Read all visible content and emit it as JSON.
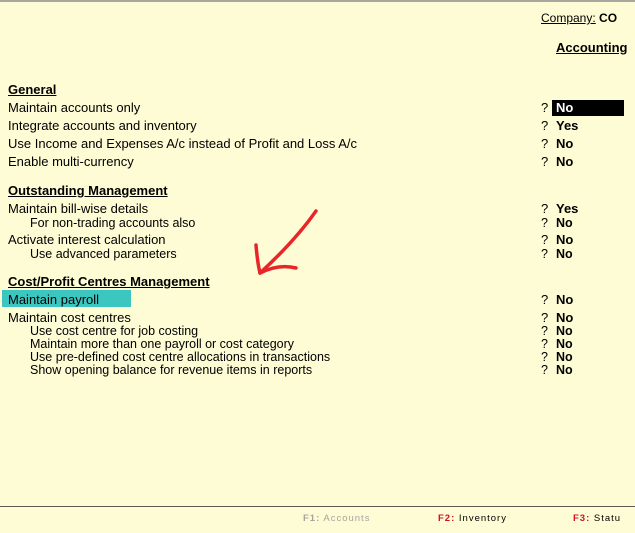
{
  "header": {
    "company_label": "Company:",
    "company_value": "CO",
    "screen_title": "Accounting"
  },
  "sections": {
    "general": {
      "heading": "General",
      "rows": [
        {
          "label": "Maintain accounts only",
          "q": "?",
          "value": "No"
        },
        {
          "label": "Integrate accounts and inventory",
          "q": "?",
          "value": "Yes"
        },
        {
          "label": "Use Income and Expenses A/c instead of Profit and Loss A/c",
          "q": "?",
          "value": "No"
        },
        {
          "label": "Enable multi-currency",
          "q": "?",
          "value": "No"
        }
      ]
    },
    "outstanding": {
      "heading": "Outstanding Management",
      "rows": [
        {
          "label": "Maintain bill-wise details",
          "q": "?",
          "value": "Yes"
        },
        {
          "label": "For non-trading accounts also",
          "q": "?",
          "value": "No"
        },
        {
          "label": "Activate interest calculation",
          "q": "?",
          "value": "No"
        },
        {
          "label": "Use advanced parameters",
          "q": "?",
          "value": "No"
        }
      ]
    },
    "cost": {
      "heading": "Cost/Profit Centres Management",
      "rows": [
        {
          "label": "Maintain payroll",
          "q": "?",
          "value": "No"
        },
        {
          "label": "Maintain cost centres",
          "q": "?",
          "value": "No"
        },
        {
          "label": "Use cost centre for job costing",
          "q": "?",
          "value": "No"
        },
        {
          "label": "Maintain more than one payroll or cost category",
          "q": "?",
          "value": "No"
        },
        {
          "label": "Use pre-defined cost centre allocations in transactions",
          "q": "?",
          "value": "No"
        },
        {
          "label": "Show opening balance for revenue items in reports",
          "q": "?",
          "value": "No"
        }
      ]
    }
  },
  "function_keys": [
    {
      "key": "F1:",
      "label": "Accounts",
      "enabled": false
    },
    {
      "key": "F2:",
      "label": "Inventory",
      "enabled": true
    },
    {
      "key": "F3:",
      "label": "Statu",
      "enabled": true
    }
  ],
  "colors": {
    "background": "#fefcd4",
    "highlight": "#3cc6c0",
    "annotation_arrow": "#e8262a",
    "fkey_accent": "#d0121e",
    "selected_value_bg": "#000000"
  },
  "annotation": {
    "arrow_icon": "hand-drawn-arrow-icon"
  }
}
